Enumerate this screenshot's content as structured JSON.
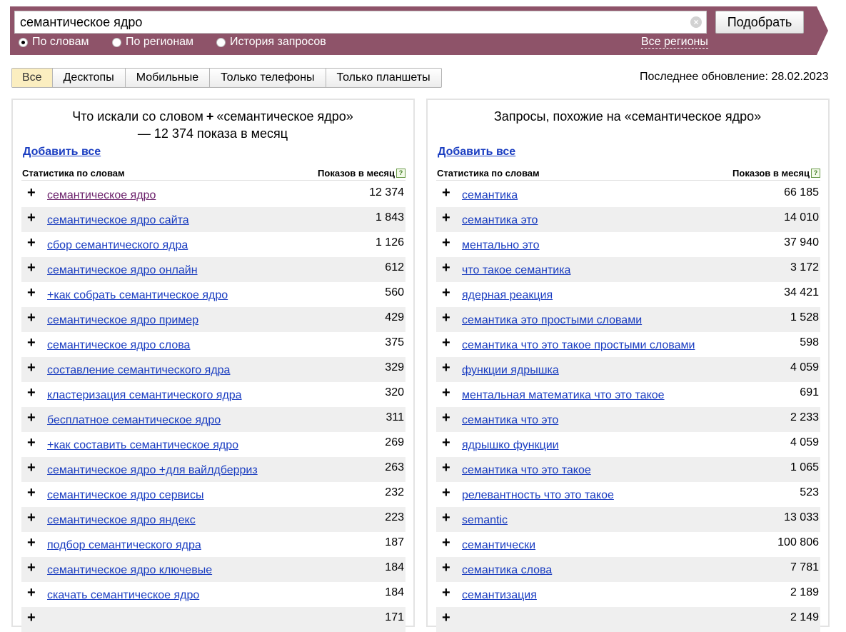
{
  "search": {
    "query": "семантическое ядро",
    "clear_symbol": "×",
    "submit_label": "Подобрать",
    "modes": [
      {
        "label": "По словам",
        "selected": true
      },
      {
        "label": "По регионам",
        "selected": false
      },
      {
        "label": "История запросов",
        "selected": false
      }
    ],
    "regions_link": "Все регионы"
  },
  "device_tabs": [
    {
      "label": "Все",
      "active": true
    },
    {
      "label": "Десктопы",
      "active": false
    },
    {
      "label": "Мобильные",
      "active": false
    },
    {
      "label": "Только телефоны",
      "active": false
    },
    {
      "label": "Только планшеты",
      "active": false
    }
  ],
  "last_update": "Последнее обновление: 28.02.2023",
  "left_panel": {
    "title_prefix": "Что искали со словом",
    "plus": "+",
    "title_suffix": "«семантическое ядро» — 12 374 показа в месяц",
    "add_all": "Добавить все",
    "col_left": "Статистика по словам",
    "col_right": "Показов в месяц",
    "help_symbol": "?",
    "rows": [
      {
        "phrase": "семантическое ядро",
        "count": "12 374",
        "visited": true
      },
      {
        "phrase": "семантическое ядро сайта",
        "count": "1 843"
      },
      {
        "phrase": "сбор семантического ядра",
        "count": "1 126"
      },
      {
        "phrase": "семантическое ядро онлайн",
        "count": "612"
      },
      {
        "phrase": "+как собрать семантическое ядро",
        "count": "560"
      },
      {
        "phrase": "семантическое ядро пример",
        "count": "429"
      },
      {
        "phrase": "семантическое ядро слова",
        "count": "375"
      },
      {
        "phrase": "составление семантического ядра",
        "count": "329"
      },
      {
        "phrase": "кластеризация семантического ядра",
        "count": "320"
      },
      {
        "phrase": "бесплатное семантическое ядро",
        "count": "311"
      },
      {
        "phrase": "+как составить семантическое ядро",
        "count": "269"
      },
      {
        "phrase": "семантическое ядро +для вайлдберриз",
        "count": "263"
      },
      {
        "phrase": "семантическое ядро сервисы",
        "count": "232"
      },
      {
        "phrase": "семантическое ядро яндекс",
        "count": "223"
      },
      {
        "phrase": "подбор семантического ядра",
        "count": "187"
      },
      {
        "phrase": "семантическое ядро ключевые",
        "count": "184"
      },
      {
        "phrase": "скачать семантическое ядро",
        "count": "184"
      },
      {
        "phrase": "",
        "count": "171"
      }
    ]
  },
  "right_panel": {
    "title": "Запросы, похожие на «семантическое ядро»",
    "add_all": "Добавить все",
    "col_left": "Статистика по словам",
    "col_right": "Показов в месяц",
    "help_symbol": "?",
    "rows": [
      {
        "phrase": "семантика",
        "count": "66 185"
      },
      {
        "phrase": "семантика это",
        "count": "14 010"
      },
      {
        "phrase": "ментально это",
        "count": "37 940"
      },
      {
        "phrase": "что такое семантика",
        "count": "3 172"
      },
      {
        "phrase": "ядерная реакция",
        "count": "34 421"
      },
      {
        "phrase": "семантика это простыми словами",
        "count": "1 528"
      },
      {
        "phrase": "семантика что это такое простыми словами",
        "count": "598"
      },
      {
        "phrase": "функции ядрышка",
        "count": "4 059"
      },
      {
        "phrase": "ментальная математика что это такое",
        "count": "691"
      },
      {
        "phrase": "семантика что это",
        "count": "2 233"
      },
      {
        "phrase": "ядрышко функции",
        "count": "4 059"
      },
      {
        "phrase": "семантика что это такое",
        "count": "1 065"
      },
      {
        "phrase": "релевантность что это такое",
        "count": "523"
      },
      {
        "phrase": "semantic",
        "count": "13 033"
      },
      {
        "phrase": "семантически",
        "count": "100 806"
      },
      {
        "phrase": "семантика слова",
        "count": "7 781"
      },
      {
        "phrase": "семантизация",
        "count": "2 189"
      },
      {
        "phrase": "",
        "count": "2 149"
      }
    ]
  },
  "colors": {
    "band": "#8e5369",
    "link": "#1a3dc1",
    "visited_link": "#6a1f6a",
    "active_tab": "#fbeec0",
    "row_alt": "#efefef"
  }
}
